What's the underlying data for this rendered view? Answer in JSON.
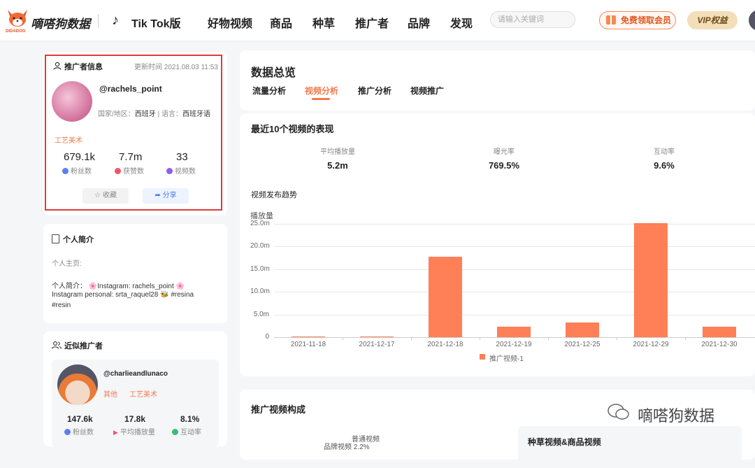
{
  "header": {
    "brand": "嘀嗒狗数据",
    "logo_sub": "DIDADOG",
    "tiktok_label": "Tik Tok版",
    "nav": [
      "好物视频",
      "商品",
      "种草",
      "推广者",
      "品牌",
      "发现"
    ],
    "search_placeholder": "请输入关键词",
    "vip_free_label": "免费领取会员",
    "vip_badge": "VIP权益"
  },
  "profile": {
    "section_title": "推广者信息",
    "update_time": "更新时间 2021.08.03 11:53",
    "handle": "@rachels_point",
    "region_label": "国家/地区：",
    "region": "西班牙",
    "language_label": "| 语言：",
    "language": "西班牙语",
    "tag": "工艺美术",
    "stats": [
      {
        "value": "679.1k",
        "label": "粉丝数",
        "color": "#5b7ef2"
      },
      {
        "value": "7.7m",
        "label": "获赞数",
        "color": "#f0556b"
      },
      {
        "value": "33",
        "label": "视频数",
        "color": "#8f5cf2"
      }
    ],
    "favorite_label": "收藏",
    "share_label": "分享"
  },
  "bio": {
    "title": "个人简介",
    "home_label": "个人主页:",
    "intro_line1": "个人简介： 🌸Instagram: rachels_point 🌸",
    "intro_line2": "Instagram personal: srta_raquel28 🐝 #resina",
    "intro_line3": "#resin"
  },
  "similar": {
    "title": "近似推广者",
    "handle": "@charlieandlunaco",
    "tags": [
      "其他",
      "工艺美术"
    ],
    "stats": [
      {
        "value": "147.6k",
        "label": "粉丝数",
        "color": "#5b7ef2"
      },
      {
        "value": "17.8k",
        "label": "平均播放量",
        "color": "#f0556b"
      },
      {
        "value": "8.1%",
        "label": "互动率",
        "color": "#3dbb74"
      }
    ]
  },
  "overview": {
    "title": "数据总览",
    "tabs": [
      "流量分析",
      "视频分析",
      "推广分析",
      "视频推广"
    ],
    "active_tab": 1
  },
  "recent": {
    "title": "最近10个视频的表现",
    "metrics": [
      {
        "label": "平均播放量",
        "value": "5.2m"
      },
      {
        "label": "曝光率",
        "value": "769.5%"
      },
      {
        "label": "互动率",
        "value": "9.6%"
      }
    ],
    "trend_title": "视频发布趋势"
  },
  "chart_data": {
    "type": "bar",
    "ylabel": "播放量",
    "y_ticks": [
      "0",
      "5.0m",
      "10.0m",
      "15.0m",
      "20.0m",
      "25.0m"
    ],
    "ylim": [
      0,
      25000000
    ],
    "categories": [
      "2021-11-18",
      "2021-12-17",
      "2021-12-18",
      "2021-12-19",
      "2021-12-25",
      "2021-12-29",
      "2021-12-30"
    ],
    "series": [
      {
        "name": "推广视频-1",
        "values": [
          100000,
          150000,
          17800000,
          2300000,
          3200000,
          25200000,
          2300000
        ],
        "color": "#ff7f56"
      }
    ],
    "grid": true,
    "legend": "bottom"
  },
  "composition": {
    "title": "推广视频构成",
    "pie_label_1": "普通视频",
    "pie_label_2": "品牌视频",
    "pie_value_2": "2.2%",
    "right_card_title": "种草视频&商品视频"
  },
  "watermark": "嘀嗒狗数据"
}
